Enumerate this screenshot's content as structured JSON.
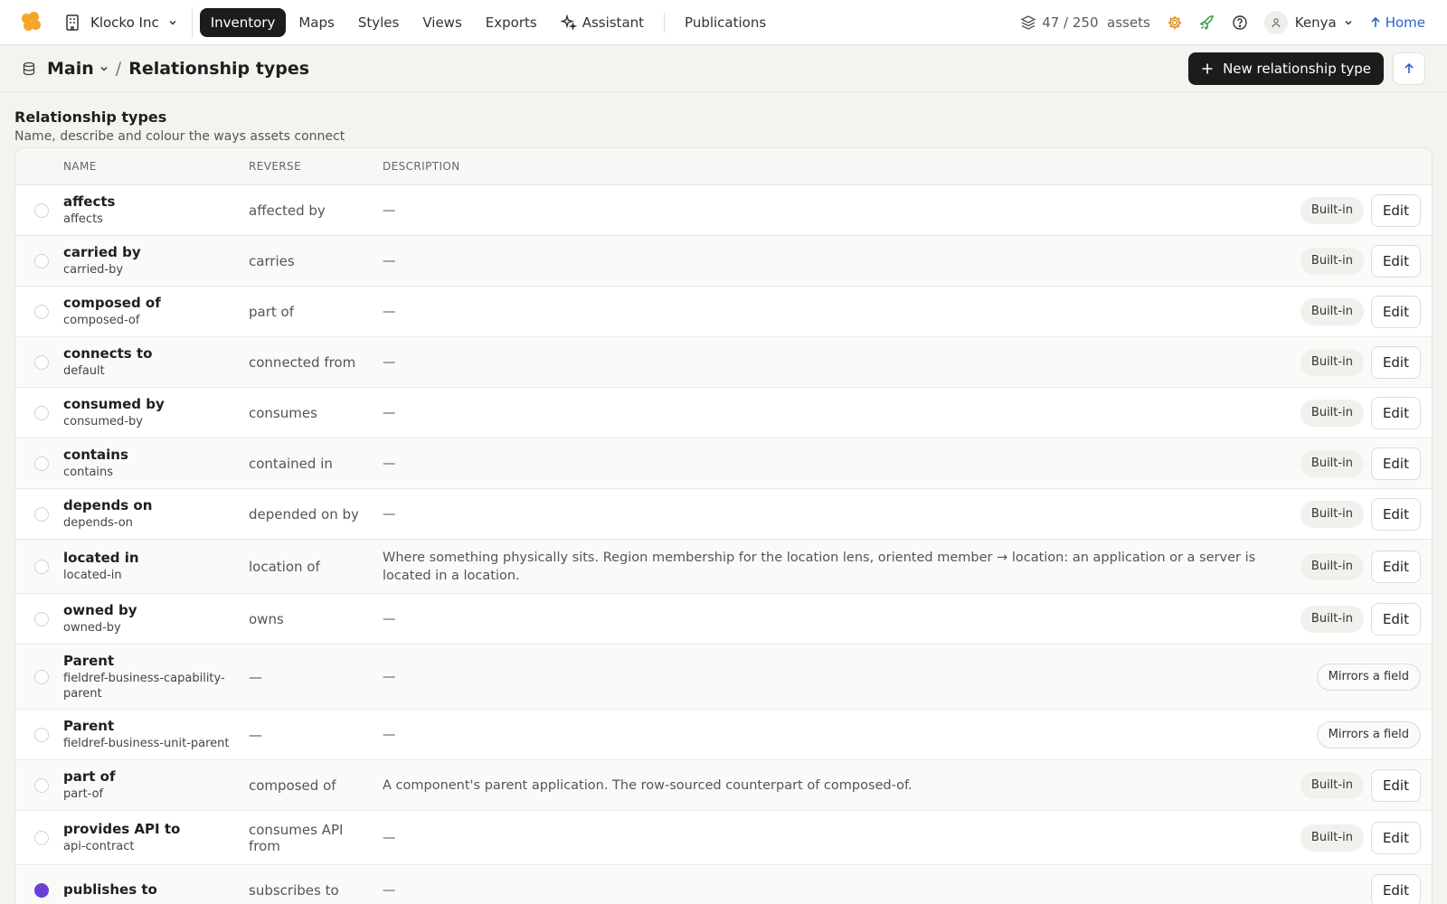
{
  "nav": {
    "org": "Klocko Inc",
    "items": [
      {
        "label": "Inventory",
        "active": true
      },
      {
        "label": "Maps"
      },
      {
        "label": "Styles"
      },
      {
        "label": "Views"
      },
      {
        "label": "Exports"
      },
      {
        "label": "Assistant"
      }
    ],
    "publications": "Publications",
    "assets": "47 / 250  assets",
    "user": "Kenya",
    "home": "Home"
  },
  "subbar": {
    "main": "Main",
    "slash": "/",
    "page": "Relationship types",
    "new_button": "New relationship type"
  },
  "section": {
    "title": "Relationship types",
    "subtitle": "Name, describe and colour the ways assets connect"
  },
  "table": {
    "headers": {
      "name": "NAME",
      "reverse": "REVERSE",
      "description": "DESCRIPTION"
    },
    "edit_label": "Edit",
    "rows": [
      {
        "name": "affects",
        "slug": "affects",
        "reverse": "affected by",
        "description": "—",
        "badge": "Built-in",
        "edit": true
      },
      {
        "name": "carried by",
        "slug": "carried-by",
        "reverse": "carries",
        "description": "—",
        "badge": "Built-in",
        "edit": true
      },
      {
        "name": "composed of",
        "slug": "composed-of",
        "reverse": "part of",
        "description": "—",
        "badge": "Built-in",
        "edit": true
      },
      {
        "name": "connects to",
        "slug": "default",
        "reverse": "connected from",
        "description": "—",
        "badge": "Built-in",
        "edit": true
      },
      {
        "name": "consumed by",
        "slug": "consumed-by",
        "reverse": "consumes",
        "description": "—",
        "badge": "Built-in",
        "edit": true
      },
      {
        "name": "contains",
        "slug": "contains",
        "reverse": "contained in",
        "description": "—",
        "badge": "Built-in",
        "edit": true
      },
      {
        "name": "depends on",
        "slug": "depends-on",
        "reverse": "depended on by",
        "description": "—",
        "badge": "Built-in",
        "edit": true
      },
      {
        "name": "located in",
        "slug": "located-in",
        "reverse": "location of",
        "description": "Where something physically sits. Region membership for the location lens, oriented member → location: an application or a server is located in a location.",
        "badge": "Built-in",
        "edit": true
      },
      {
        "name": "owned by",
        "slug": "owned-by",
        "reverse": "owns",
        "description": "—",
        "badge": "Built-in",
        "edit": true
      },
      {
        "name": "Parent",
        "slug": "fieldref-business-capability-parent",
        "reverse": "—",
        "description": "—",
        "badge": "Mirrors a field",
        "edit": false
      },
      {
        "name": "Parent",
        "slug": "fieldref-business-unit-parent",
        "reverse": "—",
        "description": "—",
        "badge": "Mirrors a field",
        "edit": false
      },
      {
        "name": "part of",
        "slug": "part-of",
        "reverse": "composed of",
        "description": "A component's parent application. The row-sourced counterpart of composed-of.",
        "badge": "Built-in",
        "edit": true
      },
      {
        "name": "provides API to",
        "slug": "api-contract",
        "reverse": "consumes API from",
        "description": "—",
        "badge": "Built-in",
        "edit": true
      },
      {
        "name": "publishes to",
        "slug": "",
        "reverse": "subscribes to",
        "description": "—",
        "badge": "",
        "edit": true,
        "selected": true
      }
    ]
  },
  "colors": {
    "accent": "#1c1c1c",
    "selected": "#6d3fd9",
    "gear": "#d98a1a",
    "rocket": "#2f9a4a",
    "home": "#2e5fc7",
    "logo": "#f4a52b"
  }
}
